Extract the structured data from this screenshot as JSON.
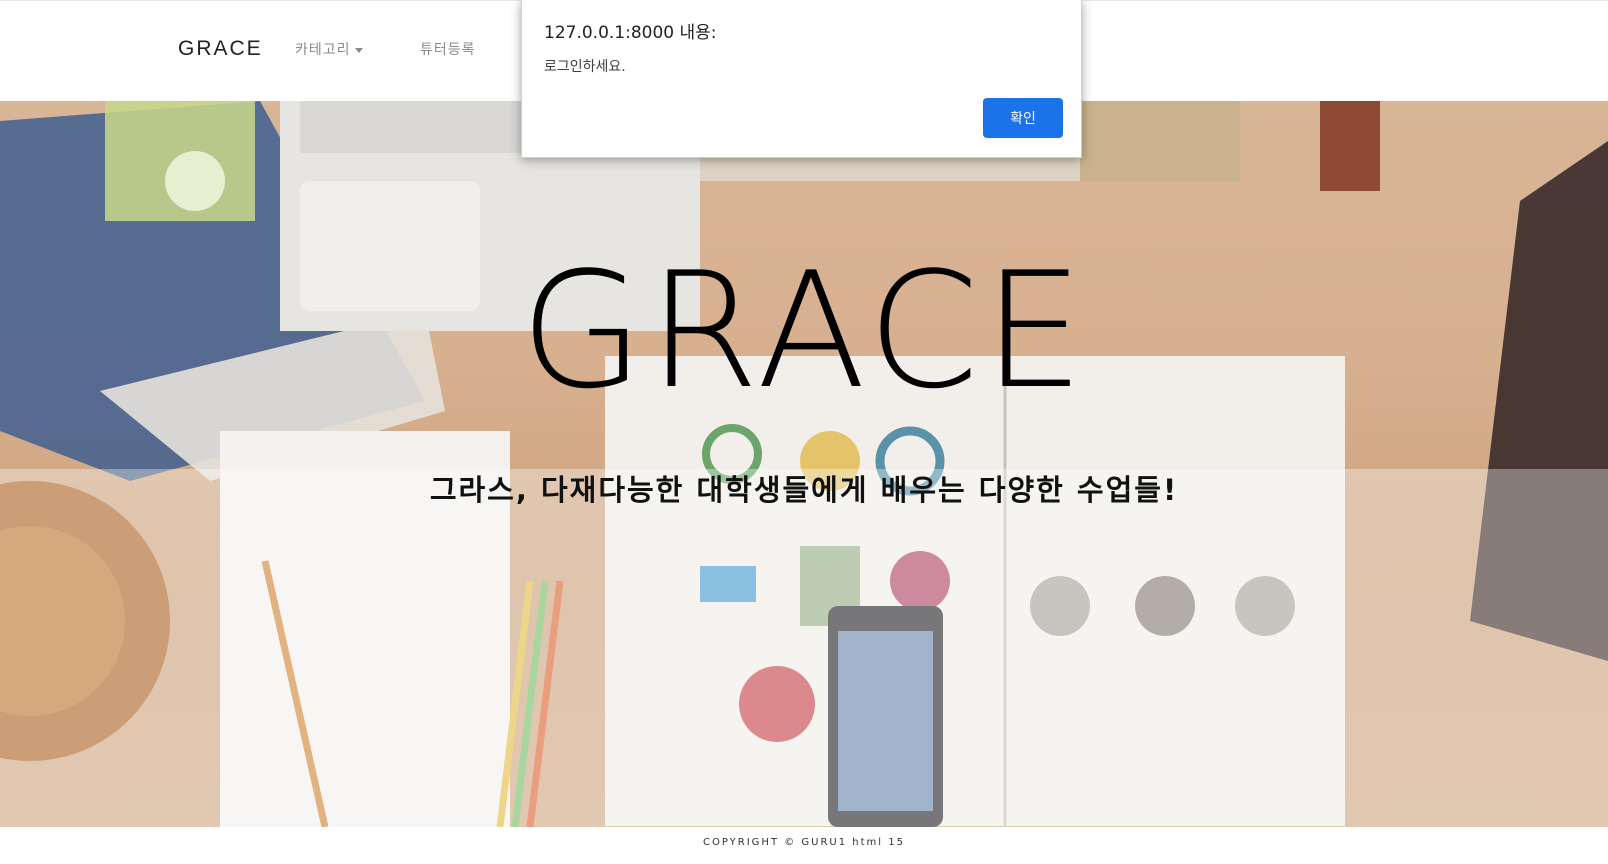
{
  "navbar": {
    "brand": "GRACE",
    "category": "카테고리",
    "tutor_register": "튜터등록"
  },
  "hero": {
    "title": "GRACE",
    "subtitle": "그라스, 다재다능한 대학생들에게 배우는 다양한 수업들!"
  },
  "footer": {
    "copyright": "COPYRIGHT © GURU1 html 15"
  },
  "alert": {
    "title": "127.0.0.1:8000 내용:",
    "message": "로그인하세요.",
    "ok_label": "확인"
  },
  "colors": {
    "primary_button": "#1a73e8",
    "hero_background": "#d7b090"
  }
}
